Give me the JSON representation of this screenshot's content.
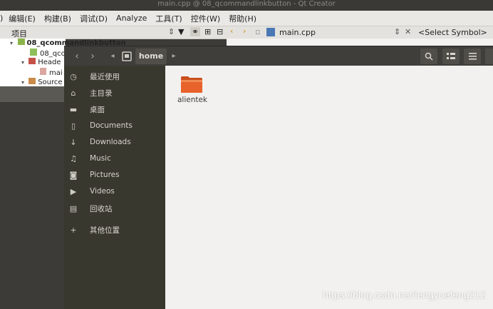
{
  "qt": {
    "title": "main.cpp @ 08_qcommandlinkbutton - Qt Creator",
    "menu": [
      "编辑(E)",
      "构建(B)",
      "调试(D)",
      "Analyze",
      "工具(T)",
      "控件(W)",
      "帮助(H)"
    ],
    "projects_label": "项目",
    "file_tab": "main.cpp",
    "symbol_select": "<Select Symbol>",
    "tree": [
      "08_qcommandlinkbutton",
      "08_qco",
      "Heade",
      "mai",
      "Source"
    ]
  },
  "files": {
    "path_segment": "home",
    "sidebar": [
      {
        "label": "最近使用",
        "icon": "clock-icon"
      },
      {
        "label": "主目录",
        "icon": "home-icon"
      },
      {
        "label": "桌面",
        "icon": "folder-icon"
      },
      {
        "label": "Documents",
        "icon": "document-icon"
      },
      {
        "label": "Downloads",
        "icon": "download-icon"
      },
      {
        "label": "Music",
        "icon": "music-icon"
      },
      {
        "label": "Pictures",
        "icon": "camera-icon"
      },
      {
        "label": "Videos",
        "icon": "video-icon"
      },
      {
        "label": "回收站",
        "icon": "trash-icon"
      },
      {
        "label": "其他位置",
        "icon": "plus-icon"
      }
    ],
    "items": [
      {
        "name": "alientek"
      }
    ]
  },
  "watermark": "https://blog.csdn.net/lengyuefeng212",
  "colors": {
    "folder": "#e8622b",
    "accent": "#f07746"
  }
}
